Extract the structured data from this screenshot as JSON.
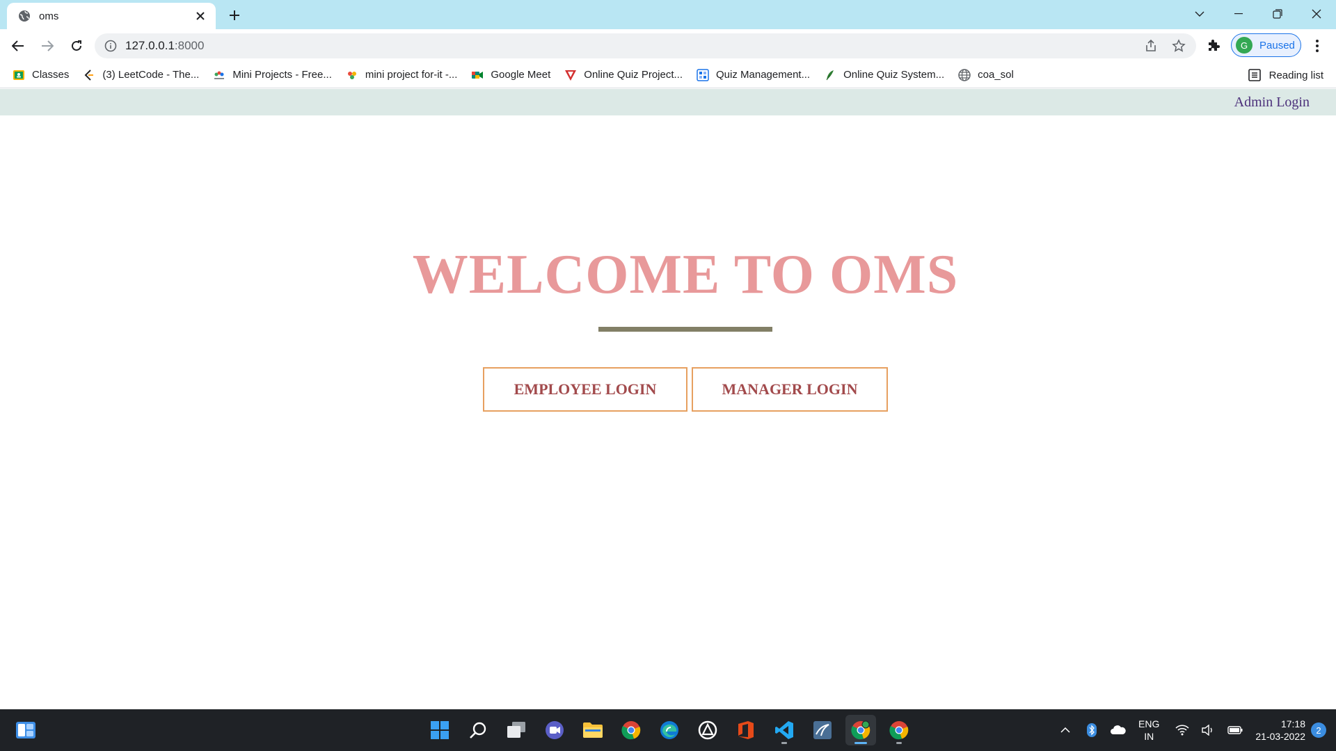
{
  "browser": {
    "tab": {
      "title": "oms",
      "favicon": "globe-icon"
    },
    "url_host": "127.0.0.1",
    "url_port": ":8000",
    "profile": {
      "initial": "G",
      "status": "Paused"
    },
    "bookmarks": [
      {
        "label": "Classes",
        "icon": "classroom-icon",
        "color": "#f4b400"
      },
      {
        "label": "(3) LeetCode - The...",
        "icon": "leetcode-icon",
        "color": "#ffa116"
      },
      {
        "label": "Mini Projects - Free...",
        "icon": "mini-projects-icon",
        "color": "#3ba55c"
      },
      {
        "label": "mini project for-it -...",
        "icon": "mini-project-icon",
        "color": "#e94b3c"
      },
      {
        "label": "Google Meet",
        "icon": "google-meet-icon",
        "color": "#00897b"
      },
      {
        "label": "Online Quiz Project...",
        "icon": "v-logo-icon",
        "color": "#d32f2f"
      },
      {
        "label": "Quiz Management...",
        "icon": "quiz-management-icon",
        "color": "#1a73e8"
      },
      {
        "label": "Online Quiz System...",
        "icon": "feather-icon",
        "color": "#2e7d32"
      },
      {
        "label": "coa_sol",
        "icon": "globe-icon",
        "color": "#5f6368"
      }
    ],
    "reading_list": "Reading list"
  },
  "page": {
    "nav": {
      "admin_login": "Admin Login"
    },
    "title": "WELCOME TO OMS",
    "buttons": {
      "employee": "EMPLOYEE LOGIN",
      "manager": "MANAGER LOGIN"
    },
    "colors": {
      "title": "#e8999a",
      "button_text": "#a24a4c",
      "button_border": "#e7a060",
      "nav_bg": "#dce9e6",
      "divider": "#827f66"
    }
  },
  "taskbar": {
    "apps": [
      {
        "name": "windows-start-icon"
      },
      {
        "name": "search-icon"
      },
      {
        "name": "task-view-icon"
      },
      {
        "name": "teams-chat-icon"
      },
      {
        "name": "file-explorer-icon"
      },
      {
        "name": "chrome-icon"
      },
      {
        "name": "edge-icon"
      },
      {
        "name": "app-icon"
      },
      {
        "name": "office-icon"
      },
      {
        "name": "vscode-icon"
      },
      {
        "name": "mysql-workbench-icon"
      },
      {
        "name": "chrome-profile-icon"
      },
      {
        "name": "chrome-icon"
      }
    ],
    "language": {
      "line1": "ENG",
      "line2": "IN"
    },
    "time": "17:18",
    "date": "21-03-2022",
    "notifications": "2"
  }
}
